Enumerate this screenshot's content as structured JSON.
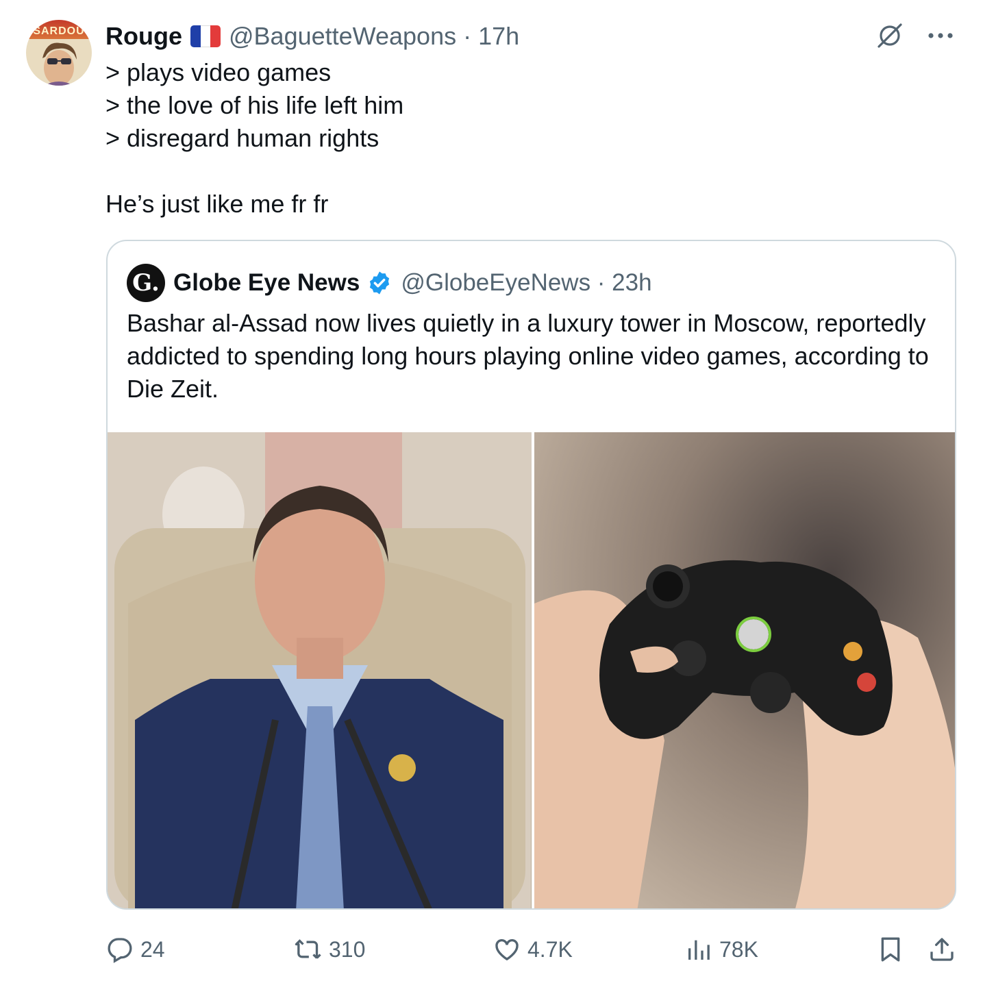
{
  "author": {
    "name": "Rouge",
    "avatar_label": "SARDOU",
    "flag": "france-flag",
    "meta": "@BaguetteWeapons · 17h"
  },
  "tweet": {
    "text": "> plays video games\n> the love of his life left him\n> disregard human rights\n\nHe’s just like me fr fr"
  },
  "quote": {
    "avatar_letter": "G.",
    "name": "Globe Eye News",
    "verified": true,
    "meta": "@GlobeEyeNews · 23h",
    "text": "Bashar al-Assad now lives quietly in a luxury tower in Moscow, reportedly addicted to spending long hours playing online video games, according to Die Zeit."
  },
  "actions": {
    "replies": "24",
    "reposts": "310",
    "likes": "4.7K",
    "views": "78K"
  },
  "colors": {
    "text": "#0f1419",
    "secondary": "#536471",
    "border": "#cfd9de",
    "verified": "#1d9bf0"
  }
}
